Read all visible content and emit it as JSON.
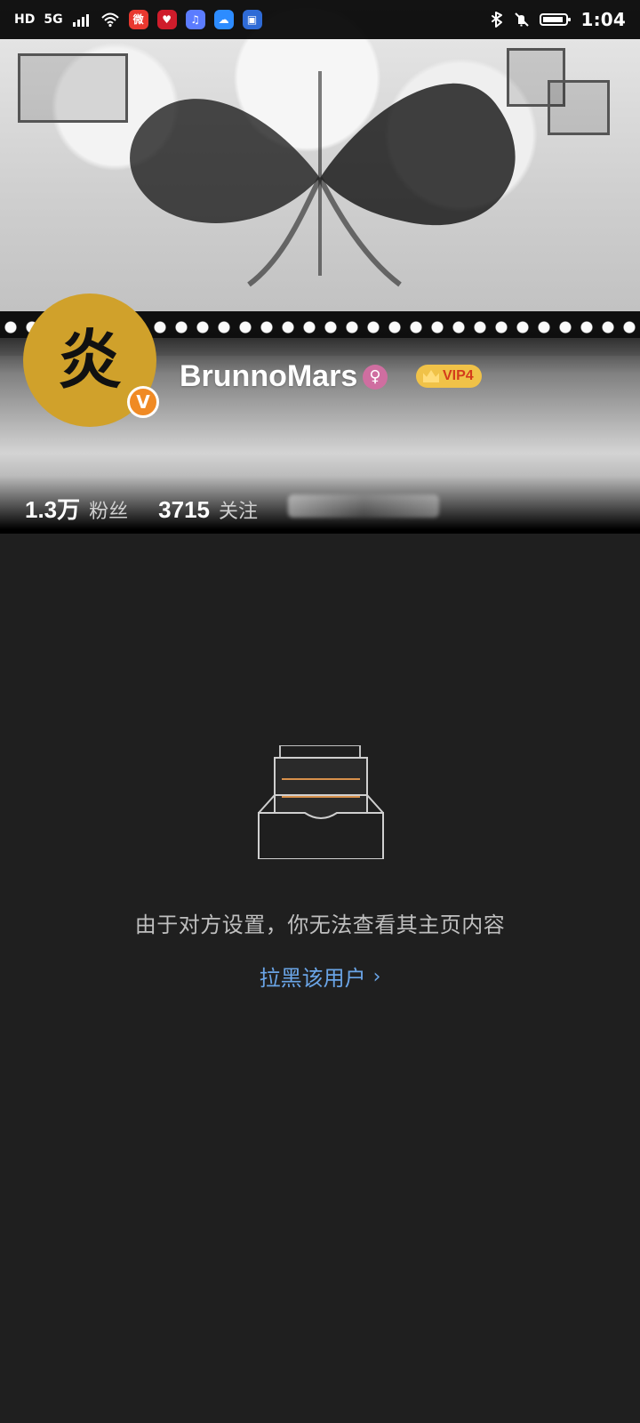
{
  "status_bar": {
    "network_text": "HD",
    "network_gen": "5G",
    "time": "1:04",
    "icons": [
      "hd-icon",
      "5g-icon",
      "signal-icon",
      "wifi-icon",
      "weibo-icon",
      "app-heart-icon",
      "music-icon",
      "cloud-icon",
      "app-square-icon",
      "bluetooth-icon",
      "mute-icon",
      "battery-icon"
    ]
  },
  "profile": {
    "avatar_char": "炎",
    "username": "BrunnoMars",
    "verified_symbol": "V",
    "gender_symbol": "♀",
    "vip_label": "VIP4",
    "stats": [
      {
        "value": "1.3万",
        "label": "粉丝"
      },
      {
        "value": "3715",
        "label": "关注"
      }
    ]
  },
  "empty_state": {
    "message": "由于对方设置，你无法查看其主页内容",
    "action_label": "拉黑该用户",
    "action_chevron": "›"
  },
  "colors": {
    "background": "#1f1f1f",
    "link": "#6aa4e6",
    "avatar": "#d0a12b",
    "vip": "#f0c248",
    "vip_text": "#d43b1b",
    "gender": "#cf6ea0",
    "verified": "#f08a24"
  }
}
